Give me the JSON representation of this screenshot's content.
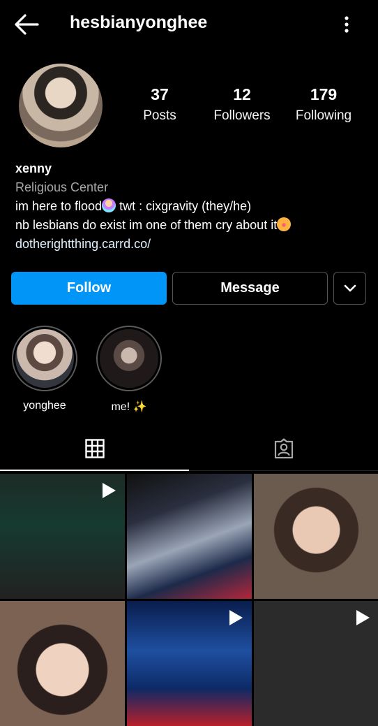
{
  "header": {
    "username": "hesbianyonghee",
    "back_icon": "arrow-left-icon",
    "more_icon": "more-vertical-icon"
  },
  "profile": {
    "stats": [
      {
        "value": "37",
        "label": "Posts"
      },
      {
        "value": "12",
        "label": "Followers"
      },
      {
        "value": "179",
        "label": "Following"
      }
    ],
    "name": "xenny",
    "category": "Religious Center",
    "bio_line1_a": "im here to flood",
    "bio_line1_b": " twt : cixgravity (they/he)",
    "bio_line2": "nb lesbians do exist im one of them cry about it",
    "link": "dotherightthing.carrd.co/"
  },
  "actions": {
    "follow_label": "Follow",
    "message_label": "Message"
  },
  "highlights": [
    {
      "label": "yonghee"
    },
    {
      "label": "me! ✨"
    }
  ],
  "tabs": [
    {
      "icon": "grid-icon"
    },
    {
      "icon": "tagged-icon"
    }
  ],
  "colors": {
    "accent": "#0095f6",
    "background": "#000000",
    "link": "#e0f1ff"
  }
}
